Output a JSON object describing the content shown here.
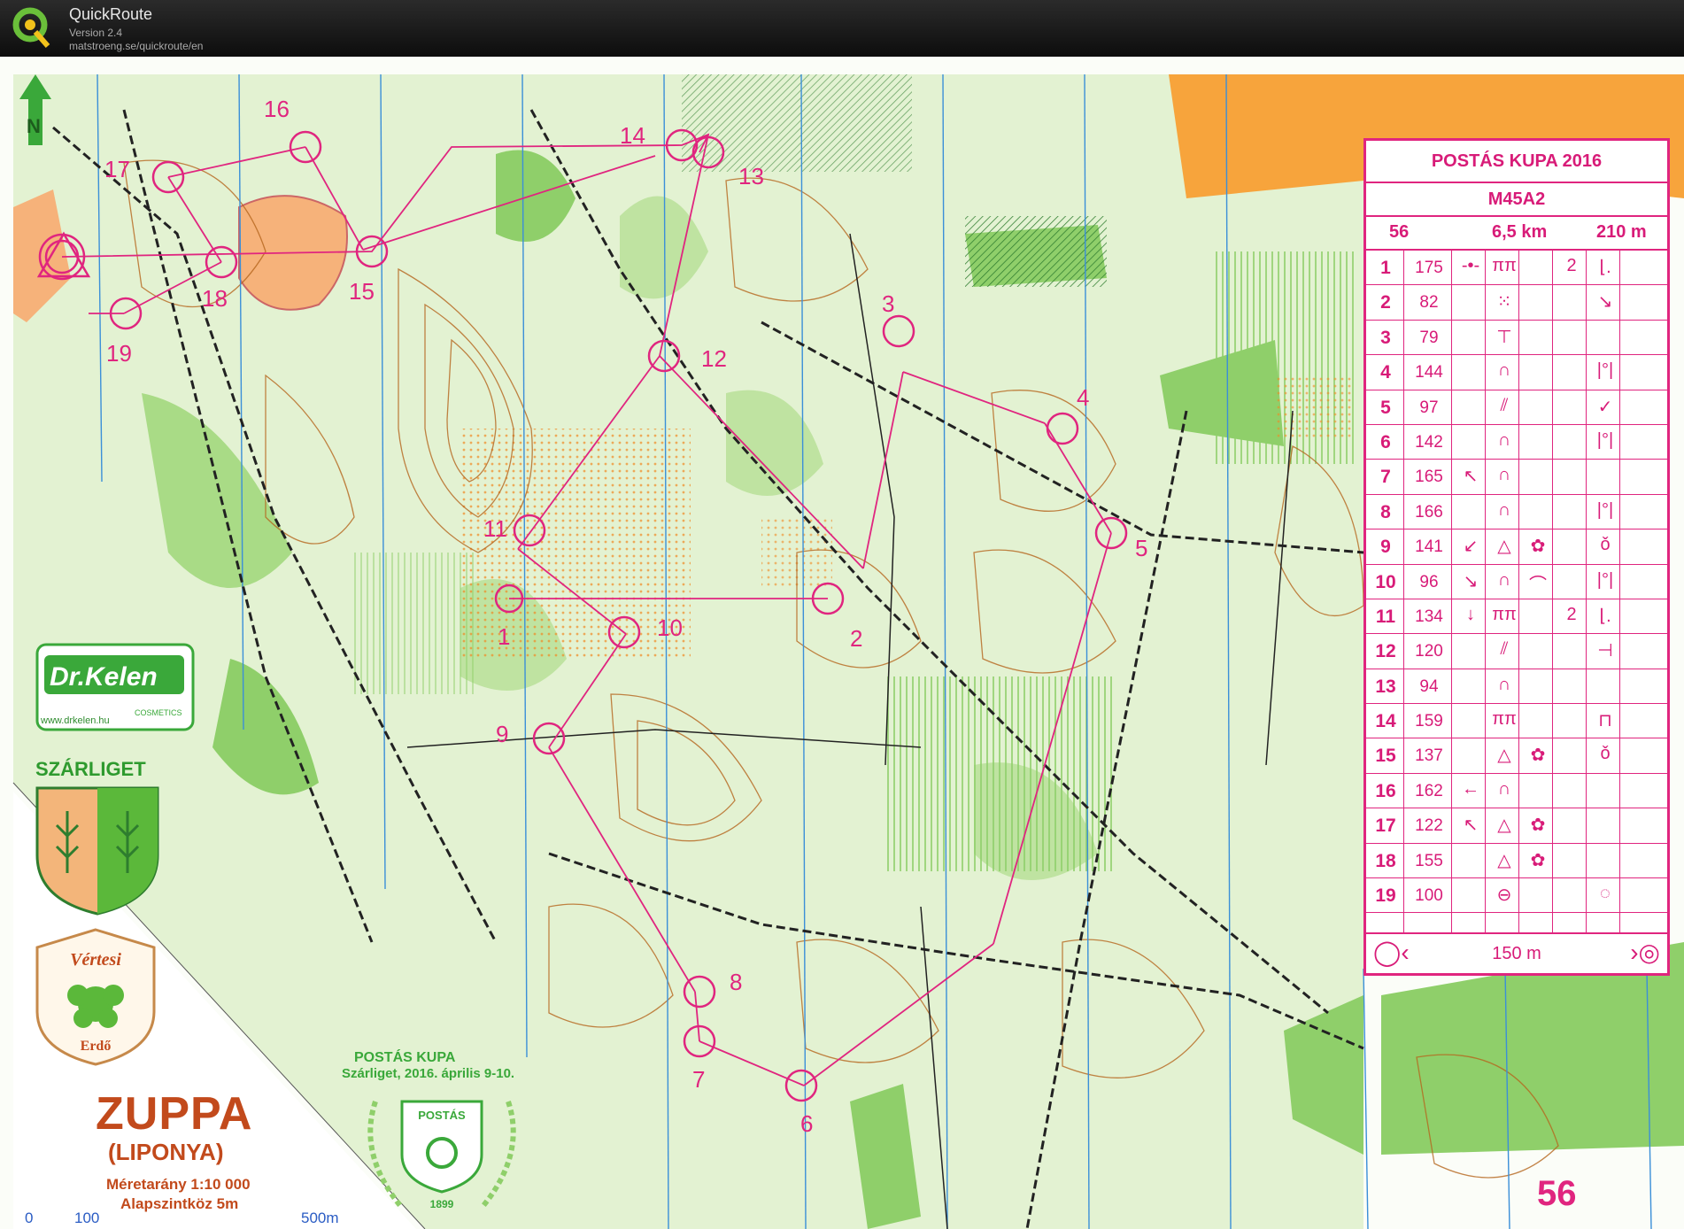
{
  "app": {
    "name": "QuickRoute",
    "version": "Version 2.4",
    "url": "matstroeng.se/quickroute/en"
  },
  "map": {
    "title": "ZUPPA",
    "subtitle": "(LIPONYA)",
    "scale_text": "Méretarány 1:10 000",
    "contour_text": "Alapszintköz 5m",
    "scalebar": [
      "0",
      "100",
      "500m"
    ],
    "sponsor_brand": "Dr.Kelen",
    "sponsor_tag": "COSMETICS",
    "sponsor_url": "www.drkelen.hu",
    "place_name": "SZÁRLIGET",
    "forest_logo_top": "Vértesi",
    "forest_logo_bottom": "Erdő",
    "event_logo_title": "POSTÁS KUPA",
    "event_logo_place": "Szárliget, 2016. április 9-10.",
    "postas_logo_text": "POSTÁS",
    "postas_logo_year": "1899",
    "course_number": "56",
    "course_class": "M45A2",
    "control_labels": [
      "1",
      "2",
      "3",
      "4",
      "5",
      "6",
      "7",
      "8",
      "9",
      "10",
      "11",
      "12",
      "13",
      "14",
      "15",
      "16",
      "17",
      "18",
      "19"
    ]
  },
  "description_sheet": {
    "title": "POSTÁS KUPA 2016",
    "class": "M45A2",
    "course": "56",
    "length": "6,5 km",
    "climb": "210 m",
    "finish_text": "150 m",
    "rows": [
      {
        "n": "1",
        "code": "175",
        "s1": "-•-",
        "s2": "ππ",
        "s3": "",
        "s4": "2",
        "s5": "⌊."
      },
      {
        "n": "2",
        "code": "82",
        "s1": "",
        "s2": "⁙",
        "s3": "",
        "s4": "",
        "s5": "↘"
      },
      {
        "n": "3",
        "code": "79",
        "s1": "",
        "s2": "⊤",
        "s3": "",
        "s4": "",
        "s5": ""
      },
      {
        "n": "4",
        "code": "144",
        "s1": "",
        "s2": "∩",
        "s3": "",
        "s4": "",
        "s5": "|°|"
      },
      {
        "n": "5",
        "code": "97",
        "s1": "",
        "s2": "⫽",
        "s3": "",
        "s4": "",
        "s5": "✓"
      },
      {
        "n": "6",
        "code": "142",
        "s1": "",
        "s2": "∩",
        "s3": "",
        "s4": "",
        "s5": "|°|"
      },
      {
        "n": "7",
        "code": "165",
        "s1": "↖",
        "s2": "∩",
        "s3": "",
        "s4": "",
        "s5": ""
      },
      {
        "n": "8",
        "code": "166",
        "s1": "",
        "s2": "∩",
        "s3": "",
        "s4": "",
        "s5": "|°|"
      },
      {
        "n": "9",
        "code": "141",
        "s1": "↙",
        "s2": "△",
        "s3": "✿",
        "s4": "",
        "s5": "ǒ"
      },
      {
        "n": "10",
        "code": "96",
        "s1": "↘",
        "s2": "∩",
        "s3": "⌒",
        "s4": "",
        "s5": "|°|"
      },
      {
        "n": "11",
        "code": "134",
        "s1": "↓",
        "s2": "ππ",
        "s3": "",
        "s4": "2",
        "s5": "⌊."
      },
      {
        "n": "12",
        "code": "120",
        "s1": "",
        "s2": "⫽",
        "s3": "",
        "s4": "",
        "s5": "⊣"
      },
      {
        "n": "13",
        "code": "94",
        "s1": "",
        "s2": "∩",
        "s3": "",
        "s4": "",
        "s5": ""
      },
      {
        "n": "14",
        "code": "159",
        "s1": "",
        "s2": "ππ",
        "s3": "",
        "s4": "",
        "s5": "⊓"
      },
      {
        "n": "15",
        "code": "137",
        "s1": "",
        "s2": "△",
        "s3": "✿",
        "s4": "",
        "s5": "ǒ"
      },
      {
        "n": "16",
        "code": "162",
        "s1": "←",
        "s2": "∩",
        "s3": "",
        "s4": "",
        "s5": ""
      },
      {
        "n": "17",
        "code": "122",
        "s1": "↖",
        "s2": "△",
        "s3": "✿",
        "s4": "",
        "s5": ""
      },
      {
        "n": "18",
        "code": "155",
        "s1": "",
        "s2": "△",
        "s3": "✿",
        "s4": "",
        "s5": ""
      },
      {
        "n": "19",
        "code": "100",
        "s1": "",
        "s2": "⊖",
        "s3": "",
        "s4": "",
        "s5": "◌"
      }
    ]
  },
  "colors": {
    "course": "#e0257f",
    "forest_green": "#8fcf6a",
    "light_green": "#d4eebf",
    "contour": "#b5651d",
    "open": "#f5a623",
    "track": "#222222",
    "magnetic_north": "#3b8fd8"
  }
}
